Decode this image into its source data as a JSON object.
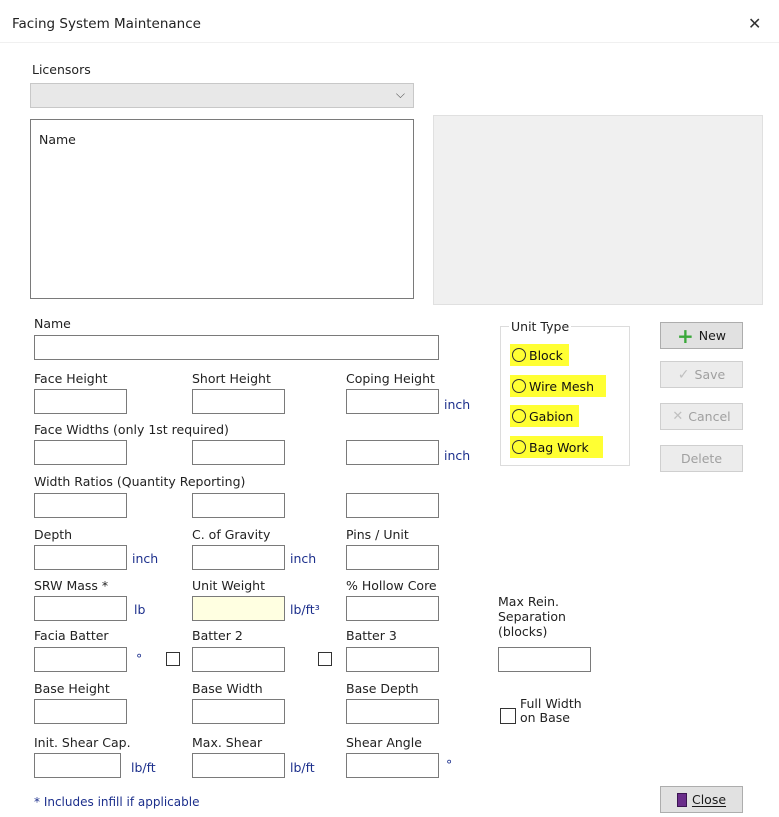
{
  "window": {
    "title": "Facing System Maintenance",
    "close_glyph": "✕"
  },
  "licensors": {
    "label": "Licensors",
    "value": ""
  },
  "list": {
    "header": "Name"
  },
  "form": {
    "name_label": "Name",
    "face_height": "Face Height",
    "short_height": "Short Height",
    "coping_height": "Coping Height",
    "face_widths": "Face Widths (only 1st required)",
    "width_ratios": "Width Ratios (Quantity Reporting)",
    "depth": "Depth",
    "c_of_gravity": "C. of Gravity",
    "pins_unit": "Pins / Unit",
    "srw_mass": "SRW Mass *",
    "unit_weight": "Unit Weight",
    "hollow_core": "% Hollow Core",
    "facia_batter": "Facia Batter",
    "batter2": "Batter 2",
    "batter3": "Batter 3",
    "base_height": "Base Height",
    "base_width": "Base Width",
    "base_depth": "Base Depth",
    "init_shear": "Init. Shear Cap.",
    "max_shear": "Max. Shear",
    "shear_angle": "Shear Angle",
    "max_rein": "Max Rein.\nSeparation\n(blocks)",
    "full_width": "Full Width\non Base",
    "footnote": "* Includes infill if applicable"
  },
  "units": {
    "inch": "inch",
    "lb": "lb",
    "lbft3": "lb/ft³",
    "degree": "°",
    "lbft": "lb/ft"
  },
  "unit_type": {
    "title": "Unit Type",
    "options": [
      "Block",
      "Wire Mesh",
      "Gabion",
      "Bag Work"
    ],
    "highlight_color": "#ffff33"
  },
  "buttons": {
    "new": "New",
    "save": "Save",
    "cancel": "Cancel",
    "delete": "Delete",
    "close": "Close"
  },
  "colors": {
    "unit_text": "#1c2f8c",
    "new_icon": "#3aa83a",
    "unit_weight_bg": "#ffffe1"
  }
}
